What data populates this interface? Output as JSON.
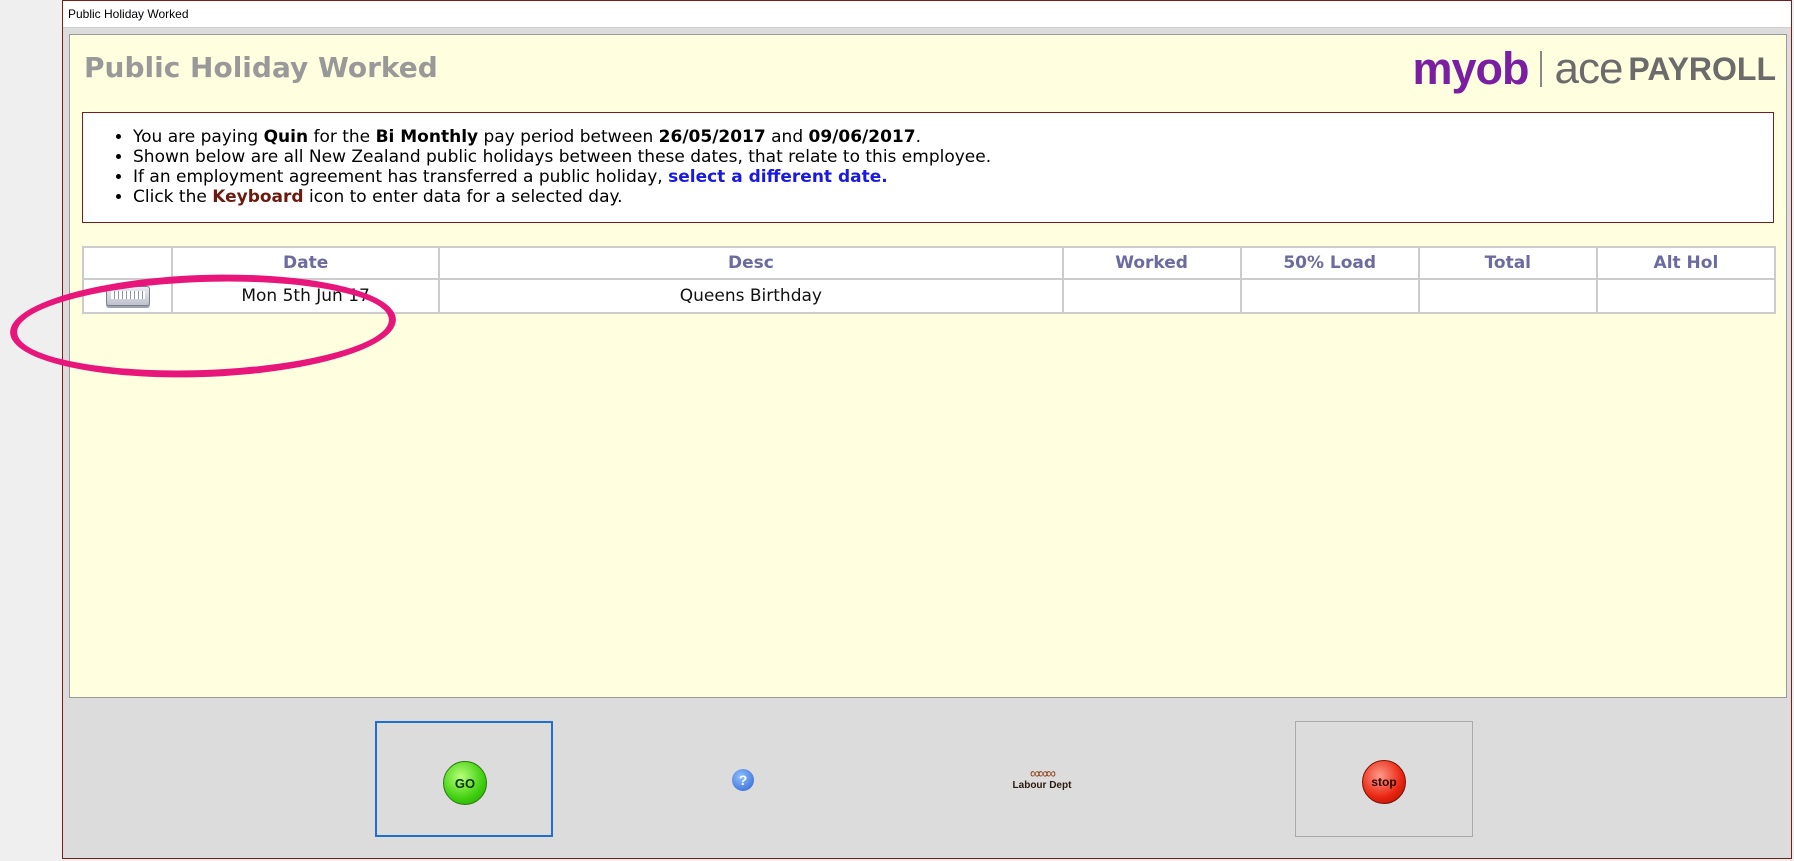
{
  "window": {
    "title": "Public Holiday Worked"
  },
  "heading": "Public Holiday Worked",
  "logo": {
    "brand": "myob",
    "ace": "ace",
    "payroll": "PAYROLL"
  },
  "info": {
    "line1": {
      "prefix": "You are paying ",
      "employee": "Quin",
      "mid1": " for the ",
      "period": "Bi Monthly",
      "mid2": " pay period between ",
      "start": "26/05/2017",
      "mid3": " and ",
      "end": "09/06/2017",
      "suffix": "."
    },
    "line2": "Shown below are all New Zealand public holidays between these dates, that relate to this employee.",
    "line3": {
      "prefix": "If an employment agreement has transferred a public holiday, ",
      "link": "select a different date."
    },
    "line4": {
      "prefix": "Click the ",
      "keyword": "Keyboard",
      "suffix": " icon to enter data for a selected day."
    }
  },
  "table": {
    "headers": {
      "icon": "",
      "date": "Date",
      "desc": "Desc",
      "worked": "Worked",
      "load": "50% Load",
      "total": "Total",
      "alt": "Alt Hol"
    },
    "rows": [
      {
        "date": "Mon 5th Jun 17",
        "desc": "Queens Birthday",
        "worked": "",
        "load": "",
        "total": "",
        "alt": ""
      }
    ]
  },
  "buttons": {
    "go": "GO",
    "help": "?",
    "labour": "Labour Dept",
    "stop": "stop"
  },
  "colors": {
    "accent": "#e8157b",
    "link": "#1a1adf",
    "header_text": "#6b6ba0",
    "brand": "#7a1fa2"
  }
}
